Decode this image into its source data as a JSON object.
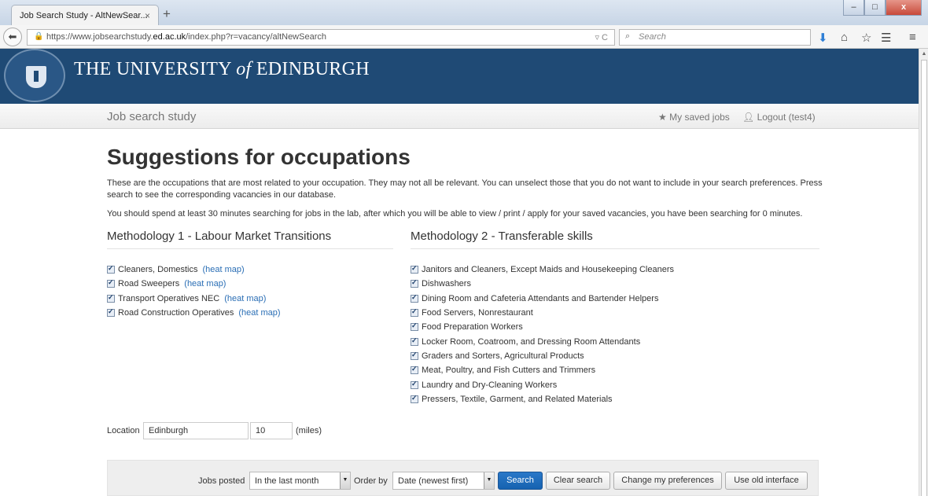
{
  "browser": {
    "tab_title": "Job Search Study - AltNewSear...",
    "tab_close": "×",
    "new_tab": "+",
    "url_prefix": "https://www.jobsearchstudy.",
    "url_domain": "ed.ac.uk",
    "url_suffix": "/index.php?r=vacancy/altNewSearch",
    "search_placeholder": "Search",
    "window_buttons": [
      "–",
      "□",
      "x"
    ]
  },
  "header": {
    "uni_pre": "THE UNIVERSITY ",
    "uni_of": "of",
    "uni_post": " EDINBURGH"
  },
  "subnav": {
    "brand": "Job search study",
    "saved_jobs": "My saved jobs",
    "logout": "Logout (test4)"
  },
  "main": {
    "title": "Suggestions for occupations",
    "intro": "These are the occupations that are most related to your occupation. They may not all be relevant. You can unselect those that you do not want to include in your search preferences. Press search to see the corresponding vacancies in our database.",
    "notice": "You should spend at least 30 minutes searching for jobs in the lab, after which you will be able to view / print / apply for your saved vacancies, you have been searching for 0 minutes.",
    "heat_map_label": "(heat map)",
    "methodology1": {
      "title": "Methodology 1 - Labour Market Transitions",
      "items": [
        {
          "label": "Cleaners, Domestics",
          "checked": true
        },
        {
          "label": "Road Sweepers",
          "checked": true
        },
        {
          "label": "Transport Operatives NEC",
          "checked": true
        },
        {
          "label": "Road Construction Operatives",
          "checked": true
        }
      ]
    },
    "methodology2": {
      "title": "Methodology 2 - Transferable skills",
      "items": [
        {
          "label": "Janitors and Cleaners, Except Maids and Housekeeping Cleaners",
          "checked": true
        },
        {
          "label": "Dishwashers",
          "checked": true
        },
        {
          "label": "Dining Room and Cafeteria Attendants and Bartender Helpers",
          "checked": true
        },
        {
          "label": "Food Servers, Nonrestaurant",
          "checked": true
        },
        {
          "label": "Food Preparation Workers",
          "checked": true
        },
        {
          "label": "Locker Room, Coatroom, and Dressing Room Attendants",
          "checked": true
        },
        {
          "label": "Graders and Sorters, Agricultural Products",
          "checked": true
        },
        {
          "label": "Meat, Poultry, and Fish Cutters and Trimmers",
          "checked": true
        },
        {
          "label": "Laundry and Dry-Cleaning Workers",
          "checked": true
        },
        {
          "label": "Pressers, Textile, Garment, and Related Materials",
          "checked": true
        }
      ]
    },
    "location": {
      "label": "Location",
      "value": "Edinburgh",
      "radius": "10",
      "unit": "(miles)"
    }
  },
  "filter": {
    "jobs_posted_label": "Jobs posted",
    "jobs_posted_value": "In the last month",
    "order_by_label": "Order by",
    "order_by_value": "Date (newest first)",
    "search_button": "Search",
    "clear_button": "Clear search",
    "preferences_button": "Change my preferences",
    "old_interface_button": "Use old interface"
  }
}
